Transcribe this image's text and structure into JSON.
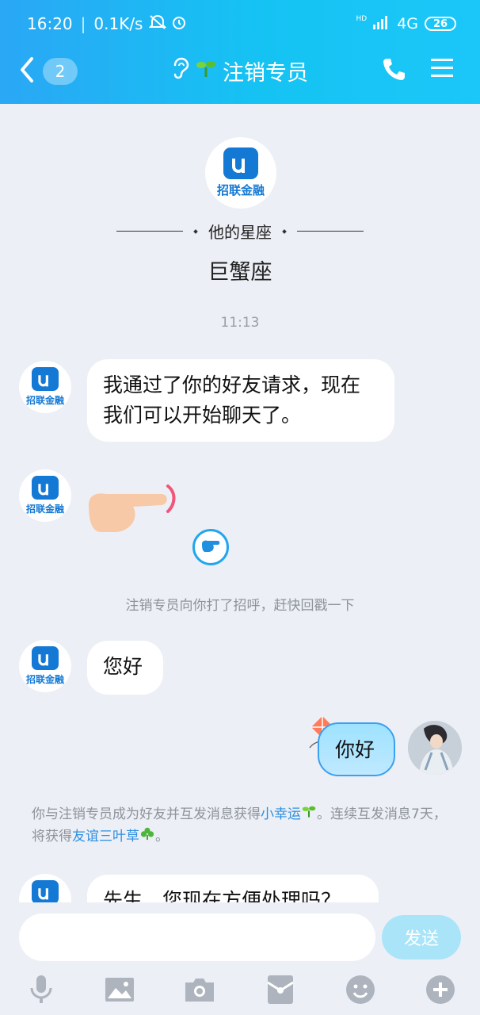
{
  "status_bar": {
    "time": "16:20",
    "speed": "0.1K/s",
    "network": "4G",
    "hd": "HD",
    "battery": "26"
  },
  "nav": {
    "badge": "2",
    "title": "注销专员"
  },
  "profile": {
    "logo_text": "招联金融",
    "zodiac_label": "他的星座",
    "zodiac_value": "巨蟹座"
  },
  "messages": {
    "time": "11:13",
    "m1": "我通过了你的好友请求，现在我们可以开始聊天了。",
    "poke_notice": "注销专员向你打了招呼，赶快回戳一下",
    "m2": "您好",
    "m3_me": "你好",
    "friend_note_pre": "你与注销专员成为好友并互发消息获得",
    "friend_note_link1": "小幸运",
    "friend_note_mid": "。连续互发消息7天，将获得",
    "friend_note_link2": "友谊三叶草",
    "friend_note_end": "。",
    "m4": "先生，您现在方便处理吗？"
  },
  "input": {
    "placeholder": "",
    "send_label": "发送"
  },
  "colors": {
    "header_start": "#2aa7f5",
    "header_end": "#1bc7f8",
    "accent": "#2d8fe2",
    "logo_blue": "#1479d4"
  },
  "icons": [
    "back-icon",
    "ear-icon",
    "sprout-icon",
    "phone-icon",
    "menu-icon",
    "mic-icon",
    "image-icon",
    "camera-icon",
    "red-packet-icon",
    "emoji-icon",
    "plus-icon"
  ]
}
